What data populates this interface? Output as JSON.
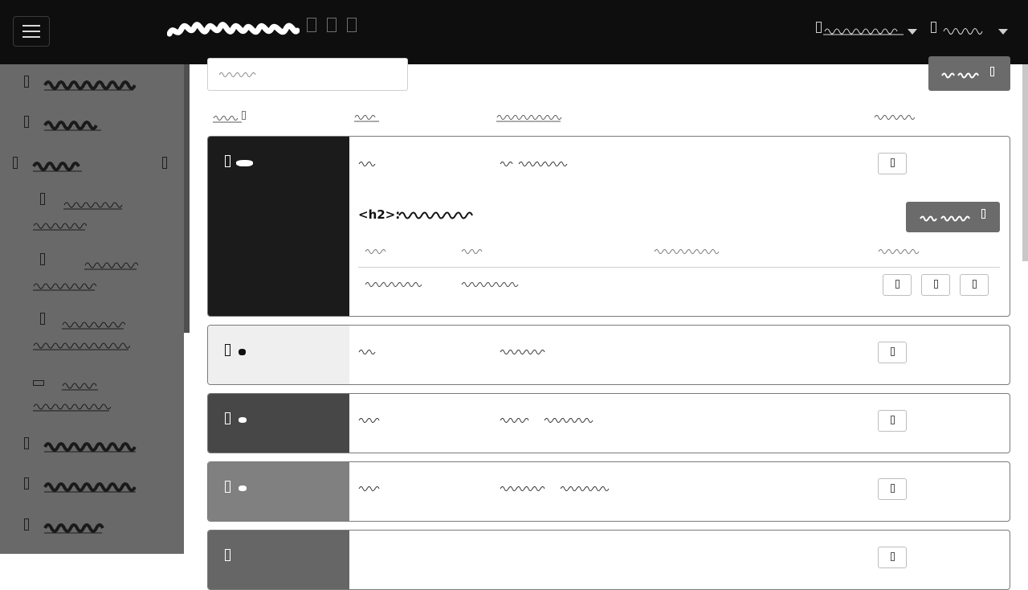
{
  "topbar": {
    "menu_button": "menu",
    "icons": [
      "nav-icon",
      "nav-icon",
      "nav-icon"
    ]
  },
  "detail": {
    "heading_prefix": "<h2>:"
  },
  "colors": {
    "topbar_bg": "#0e0e0e",
    "sidebar_bg": "#696969",
    "button_dark": "#6b6b6b",
    "row1_left": "#1b1b1b",
    "row2_left": "#efefef",
    "row3_left": "#474747",
    "row4_left": "#808080",
    "row5_left": "#666666"
  }
}
